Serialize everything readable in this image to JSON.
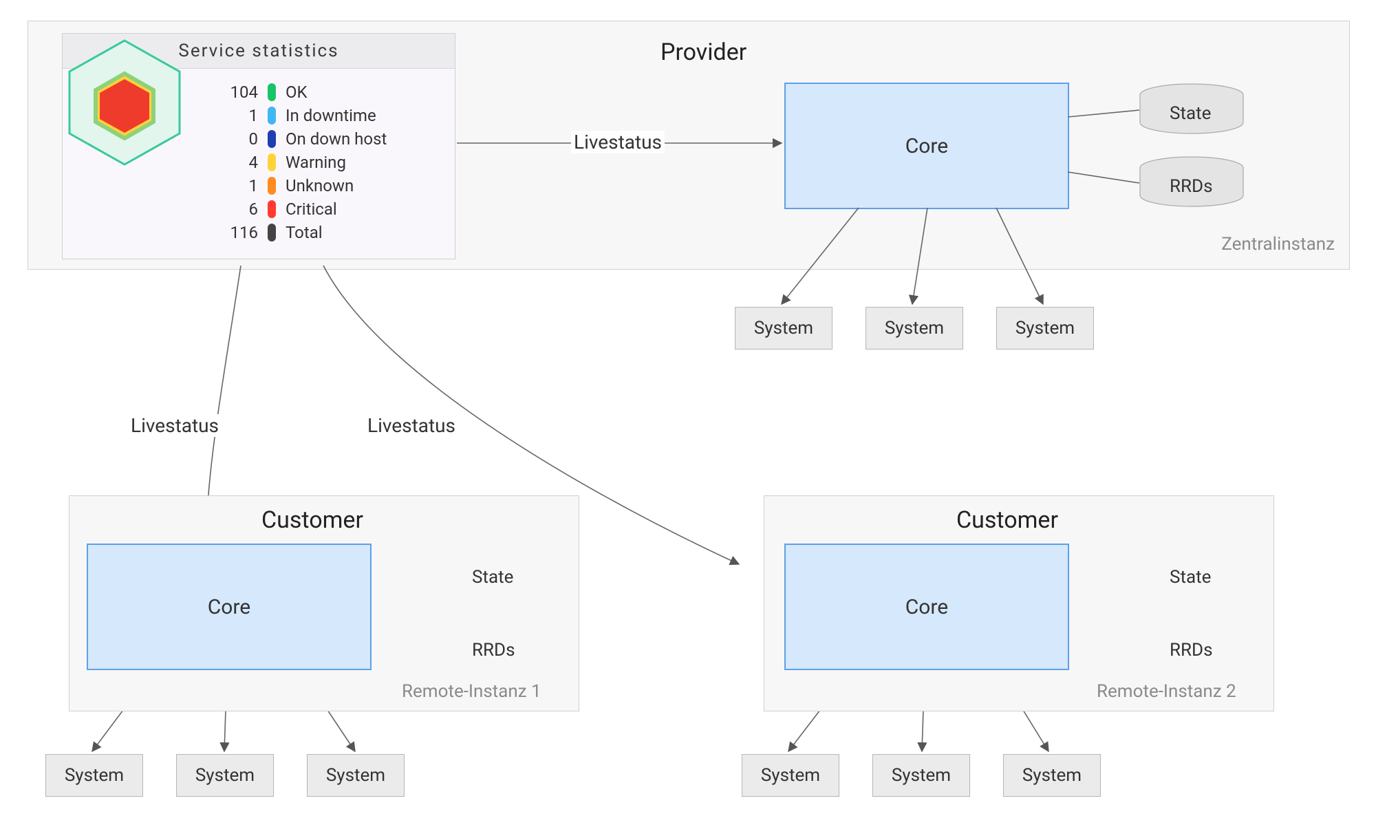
{
  "provider": {
    "title": "Provider",
    "footer": "Zentralinstanz",
    "core_label": "Core",
    "db_state": "State",
    "db_rrds": "RRDs",
    "systems": [
      "System",
      "System",
      "System"
    ]
  },
  "customer1": {
    "title": "Customer",
    "footer": "Remote-Instanz 1",
    "core_label": "Core",
    "db_state": "State",
    "db_rrds": "RRDs",
    "systems": [
      "System",
      "System",
      "System"
    ]
  },
  "customer2": {
    "title": "Customer",
    "footer": "Remote-Instanz 2",
    "core_label": "Core",
    "db_state": "State",
    "db_rrds": "RRDs",
    "systems": [
      "System",
      "System",
      "System"
    ]
  },
  "edges": {
    "livestatus_provider": "Livestatus",
    "livestatus_c1": "Livestatus",
    "livestatus_c2": "Livestatus"
  },
  "stats": {
    "title": "Service statistics",
    "rows": [
      {
        "count": "104",
        "color": "#18c46a",
        "label": "OK"
      },
      {
        "count": "1",
        "color": "#3fb7f4",
        "label": "In downtime"
      },
      {
        "count": "0",
        "color": "#1e3fb0",
        "label": "On down host"
      },
      {
        "count": "4",
        "color": "#ffd23a",
        "label": "Warning"
      },
      {
        "count": "1",
        "color": "#ff8a1f",
        "label": "Unknown"
      },
      {
        "count": "6",
        "color": "#ff3b30",
        "label": "Critical"
      },
      {
        "count": "116",
        "color": "#444",
        "label": "Total"
      }
    ]
  }
}
